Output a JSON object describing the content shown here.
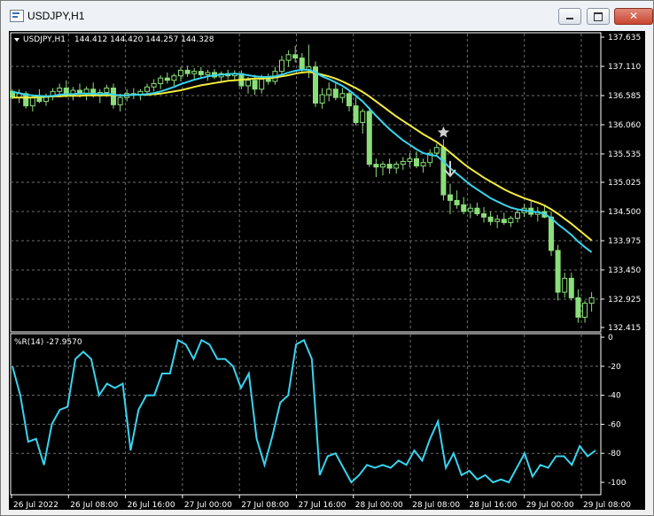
{
  "window": {
    "title": "USDJPY,H1",
    "buttons": {
      "minimize": "minimize",
      "maximize": "maximize",
      "close": "✕"
    }
  },
  "colors": {
    "background": "#000000",
    "grid": "#6e6e6e",
    "axis_text": "#ffffff",
    "candle": "#8bde7a",
    "ma_fast": "#38d4ef",
    "ma_slow": "#f4ec3c",
    "wpr": "#38d4ef",
    "marker": "#d0d0d0"
  },
  "chart_data": [
    {
      "type": "candlestick",
      "title": "USDJPY,H1  144.412 144.420 144.257 144.328",
      "symbol_label": "USDJPY,H1",
      "ohlc_label": "144.412 144.420 144.257 144.328",
      "ylim": [
        132.415,
        137.635
      ],
      "y_ticks": [
        "137.635",
        "137.110",
        "136.585",
        "136.060",
        "135.535",
        "135.025",
        "134.500",
        "133.975",
        "133.450",
        "132.925",
        "132.415"
      ],
      "x_ticks": [
        "26 Jul 2022",
        "26 Jul 08:00",
        "26 Jul 16:00",
        "27 Jul 00:00",
        "27 Jul 08:00",
        "27 Jul 16:00",
        "28 Jul 00:00",
        "28 Jul 08:00",
        "28 Jul 16:00",
        "29 Jul 00:00",
        "29 Jul 08:00"
      ],
      "candles": [
        [
          136.66,
          136.7,
          136.52,
          136.55
        ],
        [
          136.55,
          136.7,
          136.45,
          136.62
        ],
        [
          136.62,
          136.66,
          136.35,
          136.4
        ],
        [
          136.4,
          136.6,
          136.3,
          136.55
        ],
        [
          136.55,
          136.7,
          136.45,
          136.48
        ],
        [
          136.48,
          136.62,
          136.4,
          136.58
        ],
        [
          136.58,
          136.72,
          136.5,
          136.66
        ],
        [
          136.66,
          136.8,
          136.58,
          136.72
        ],
        [
          136.72,
          136.86,
          136.55,
          136.6
        ],
        [
          136.6,
          136.74,
          136.5,
          136.68
        ],
        [
          136.68,
          136.8,
          136.55,
          136.62
        ],
        [
          136.62,
          136.75,
          136.5,
          136.7
        ],
        [
          136.7,
          136.82,
          136.55,
          136.58
        ],
        [
          136.58,
          136.7,
          136.45,
          136.64
        ],
        [
          136.64,
          136.78,
          136.56,
          136.72
        ],
        [
          136.72,
          136.8,
          136.35,
          136.42
        ],
        [
          136.42,
          136.62,
          136.3,
          136.55
        ],
        [
          136.55,
          136.7,
          136.48,
          136.62
        ],
        [
          136.62,
          136.72,
          136.52,
          136.6
        ],
        [
          136.6,
          136.7,
          136.5,
          136.66
        ],
        [
          136.66,
          136.8,
          136.58,
          136.74
        ],
        [
          136.74,
          136.88,
          136.66,
          136.8
        ],
        [
          136.8,
          136.95,
          136.7,
          136.9
        ],
        [
          136.9,
          137.0,
          136.8,
          136.86
        ],
        [
          136.86,
          136.98,
          136.76,
          136.94
        ],
        [
          136.94,
          137.1,
          136.84,
          137.04
        ],
        [
          137.04,
          137.12,
          136.92,
          136.98
        ],
        [
          136.98,
          137.08,
          136.86,
          137.02
        ],
        [
          137.02,
          137.1,
          136.9,
          136.96
        ],
        [
          136.96,
          137.05,
          136.85,
          137.0
        ],
        [
          137.0,
          137.06,
          136.88,
          136.92
        ],
        [
          136.92,
          137.02,
          136.82,
          136.98
        ],
        [
          136.98,
          137.05,
          136.88,
          136.94
        ],
        [
          136.94,
          137.04,
          136.86,
          136.98
        ],
        [
          136.98,
          137.04,
          136.7,
          136.76
        ],
        [
          136.76,
          136.92,
          136.62,
          136.86
        ],
        [
          136.86,
          136.96,
          136.6,
          136.7
        ],
        [
          136.7,
          136.96,
          136.62,
          136.88
        ],
        [
          136.88,
          136.98,
          136.78,
          136.84
        ],
        [
          136.84,
          137.1,
          136.78,
          137.02
        ],
        [
          137.02,
          137.3,
          136.95,
          137.22
        ],
        [
          137.22,
          137.4,
          137.1,
          137.32
        ],
        [
          137.32,
          137.48,
          137.18,
          137.26
        ],
        [
          137.26,
          137.35,
          136.98,
          137.05
        ],
        [
          137.05,
          137.5,
          136.9,
          137.1
        ],
        [
          137.1,
          137.2,
          136.38,
          136.45
        ],
        [
          136.45,
          136.72,
          136.35,
          136.6
        ],
        [
          136.6,
          136.82,
          136.48,
          136.7
        ],
        [
          136.7,
          136.8,
          136.5,
          136.55
        ],
        [
          136.55,
          136.72,
          136.45,
          136.62
        ],
        [
          136.62,
          136.68,
          136.3,
          136.4
        ],
        [
          136.4,
          136.55,
          136.05,
          136.1
        ],
        [
          136.1,
          136.35,
          135.9,
          136.3
        ],
        [
          136.3,
          136.38,
          135.3,
          135.35
        ],
        [
          135.35,
          135.45,
          135.12,
          135.3
        ],
        [
          135.3,
          135.4,
          135.15,
          135.35
        ],
        [
          135.35,
          135.45,
          135.18,
          135.28
        ],
        [
          135.28,
          135.4,
          135.18,
          135.35
        ],
        [
          135.35,
          135.48,
          135.25,
          135.4
        ],
        [
          135.4,
          135.55,
          135.3,
          135.45
        ],
        [
          135.45,
          135.58,
          135.28,
          135.32
        ],
        [
          135.32,
          135.45,
          135.2,
          135.38
        ],
        [
          135.38,
          135.62,
          135.3,
          135.55
        ],
        [
          135.55,
          135.72,
          135.48,
          135.65
        ],
        [
          135.65,
          135.8,
          134.7,
          134.8
        ],
        [
          134.8,
          135.0,
          134.45,
          134.7
        ],
        [
          134.7,
          134.88,
          134.55,
          134.62
        ],
        [
          134.62,
          134.76,
          134.45,
          134.5
        ],
        [
          134.5,
          134.64,
          134.38,
          134.56
        ],
        [
          134.56,
          134.66,
          134.42,
          134.46
        ],
        [
          134.46,
          134.58,
          134.3,
          134.4
        ],
        [
          134.4,
          134.5,
          134.25,
          134.32
        ],
        [
          134.32,
          134.44,
          134.2,
          134.36
        ],
        [
          134.36,
          134.48,
          134.26,
          134.3
        ],
        [
          134.3,
          134.42,
          134.22,
          134.38
        ],
        [
          134.38,
          134.55,
          134.3,
          134.48
        ],
        [
          134.48,
          134.64,
          134.4,
          134.56
        ],
        [
          134.56,
          134.68,
          134.4,
          134.45
        ],
        [
          134.45,
          134.58,
          134.32,
          134.5
        ],
        [
          134.5,
          134.62,
          134.38,
          134.4
        ],
        [
          134.4,
          134.5,
          133.7,
          133.8
        ],
        [
          133.8,
          133.9,
          132.9,
          133.05
        ],
        [
          133.05,
          133.4,
          132.95,
          133.3
        ],
        [
          133.3,
          133.4,
          132.9,
          132.95
        ],
        [
          132.95,
          133.1,
          132.5,
          132.6
        ],
        [
          132.6,
          132.9,
          132.5,
          132.85
        ],
        [
          132.85,
          133.05,
          132.7,
          132.95
        ]
      ],
      "ma_fast": [
        136.65,
        136.63,
        136.6,
        136.59,
        136.58,
        136.57,
        136.58,
        136.6,
        136.61,
        136.61,
        136.62,
        136.62,
        136.62,
        136.61,
        136.62,
        136.6,
        136.59,
        136.59,
        136.6,
        136.6,
        136.61,
        136.63,
        136.66,
        136.7,
        136.74,
        136.79,
        136.83,
        136.87,
        136.9,
        136.93,
        136.95,
        136.96,
        136.97,
        136.98,
        136.97,
        136.95,
        136.93,
        136.92,
        136.92,
        136.93,
        136.96,
        137.0,
        137.03,
        137.05,
        137.05,
        137.0,
        136.93,
        136.88,
        136.82,
        136.76,
        136.68,
        136.58,
        136.48,
        136.35,
        136.22,
        136.1,
        135.98,
        135.88,
        135.78,
        135.7,
        135.62,
        135.55,
        135.52,
        135.5,
        135.4,
        135.28,
        135.18,
        135.08,
        134.98,
        134.9,
        134.82,
        134.74,
        134.68,
        134.62,
        134.57,
        134.54,
        134.52,
        134.5,
        134.49,
        134.46,
        134.38,
        134.27,
        134.18,
        134.08,
        133.96,
        133.86,
        133.77
      ],
      "ma_slow": [
        136.55,
        136.55,
        136.55,
        136.55,
        136.56,
        136.56,
        136.57,
        136.57,
        136.58,
        136.58,
        136.58,
        136.59,
        136.59,
        136.59,
        136.59,
        136.59,
        136.59,
        136.59,
        136.6,
        136.6,
        136.6,
        136.61,
        136.62,
        136.64,
        136.66,
        136.68,
        136.71,
        136.74,
        136.77,
        136.79,
        136.81,
        136.83,
        136.85,
        136.86,
        136.87,
        136.88,
        136.89,
        136.89,
        136.9,
        136.91,
        136.93,
        136.95,
        136.98,
        137.0,
        137.01,
        136.99,
        136.96,
        136.93,
        136.89,
        136.84,
        136.78,
        136.72,
        136.65,
        136.57,
        136.48,
        136.39,
        136.3,
        136.21,
        136.13,
        136.05,
        135.97,
        135.89,
        135.82,
        135.75,
        135.66,
        135.56,
        135.46,
        135.36,
        135.27,
        135.19,
        135.11,
        135.04,
        134.97,
        134.9,
        134.84,
        134.79,
        134.74,
        134.7,
        134.66,
        134.61,
        134.54,
        134.46,
        134.37,
        134.28,
        134.18,
        134.08,
        133.98
      ],
      "markers": [
        {
          "type": "star",
          "index": 64,
          "price": 135.92
        },
        {
          "type": "arrow-down",
          "index": 65,
          "price": 135.25
        }
      ]
    },
    {
      "type": "line",
      "title": "%R(14) -27.9570",
      "label": "%R(14) -27.9570",
      "ylim": [
        -100,
        0
      ],
      "y_ticks": [
        "0",
        "-20",
        "-40",
        "-60",
        "-80",
        "-100"
      ],
      "values": [
        -20,
        -40,
        -72,
        -70,
        -88,
        -60,
        -50,
        -48,
        -15,
        -10,
        -15,
        -40,
        -32,
        -35,
        -32,
        -78,
        -50,
        -40,
        -40,
        -25,
        -25,
        -2,
        -5,
        -15,
        -2,
        -5,
        -15,
        -15,
        -20,
        -35,
        -25,
        -70,
        -88,
        -68,
        -45,
        -40,
        -5,
        -2,
        -15,
        -95,
        -82,
        -80,
        -90,
        -100,
        -95,
        -88,
        -90,
        -88,
        -90,
        -85,
        -88,
        -78,
        -85,
        -70,
        -58,
        -90,
        -80,
        -95,
        -92,
        -98,
        -95,
        -100,
        -98,
        -100,
        -90,
        -80,
        -96,
        -88,
        -90,
        -82,
        -82,
        -88,
        -75,
        -82,
        -78
      ]
    }
  ]
}
